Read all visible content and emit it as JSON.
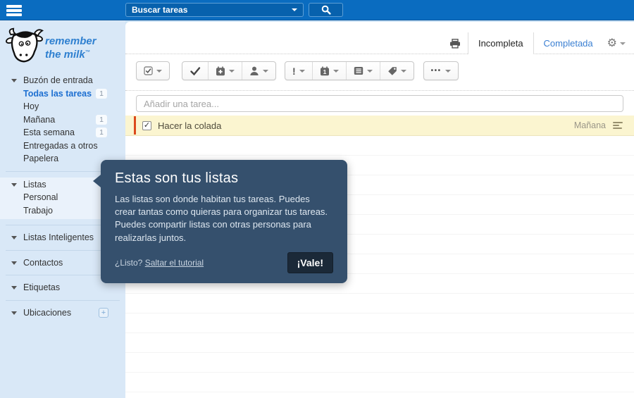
{
  "topbar": {
    "search_placeholder": "Buscar tareas"
  },
  "logo": {
    "line1": "remember",
    "line2": "the milk",
    "tm": "™"
  },
  "sidebar": {
    "items": [
      {
        "label": "Buzón de entrada"
      },
      {
        "label": "Todas las tareas",
        "count": "1"
      },
      {
        "label": "Hoy"
      },
      {
        "label": "Mañana",
        "count": "1"
      },
      {
        "label": "Esta semana",
        "count": "1"
      },
      {
        "label": "Entregadas a otros"
      },
      {
        "label": "Papelera"
      }
    ],
    "lists": {
      "header": "Listas",
      "children": [
        {
          "label": "Personal"
        },
        {
          "label": "Trabajo"
        }
      ]
    },
    "sections": [
      {
        "label": "Listas Inteligentes"
      },
      {
        "label": "Contactos"
      },
      {
        "label": "Etiquetas"
      },
      {
        "label": "Ubicaciones"
      }
    ]
  },
  "main": {
    "tabs": {
      "incomplete": "Incompleta",
      "complete": "Completada"
    },
    "add_task_placeholder": "Añadir una tarea...",
    "tasks": [
      {
        "title": "Hacer la colada",
        "due": "Mañana"
      }
    ]
  },
  "tooltip": {
    "title": "Estas son tus listas",
    "body": "Las listas son donde habitan tus tareas. Puedes crear tantas como quieras para organizar tus tareas. Puedes compartir listas con otras personas para realizarlas juntos.",
    "ready": "¿Listo?",
    "skip_link": "Saltar el tutorial",
    "ok_button": "¡Vale!"
  },
  "icons": {
    "gear": "⚙",
    "ellipsis": "•••",
    "exclaim": "!",
    "calendar_day": "1",
    "plus": "+",
    "check": "✓"
  },
  "colors": {
    "topbar": "#0a6cc0",
    "sidebar_bg": "#d9e8f7",
    "accent_blue": "#1d6fd1",
    "task_highlight": "#fbf5d0",
    "priority_bar": "#dc491b",
    "tooltip_bg": "#35506d",
    "tooltip_button": "#1b2938"
  }
}
